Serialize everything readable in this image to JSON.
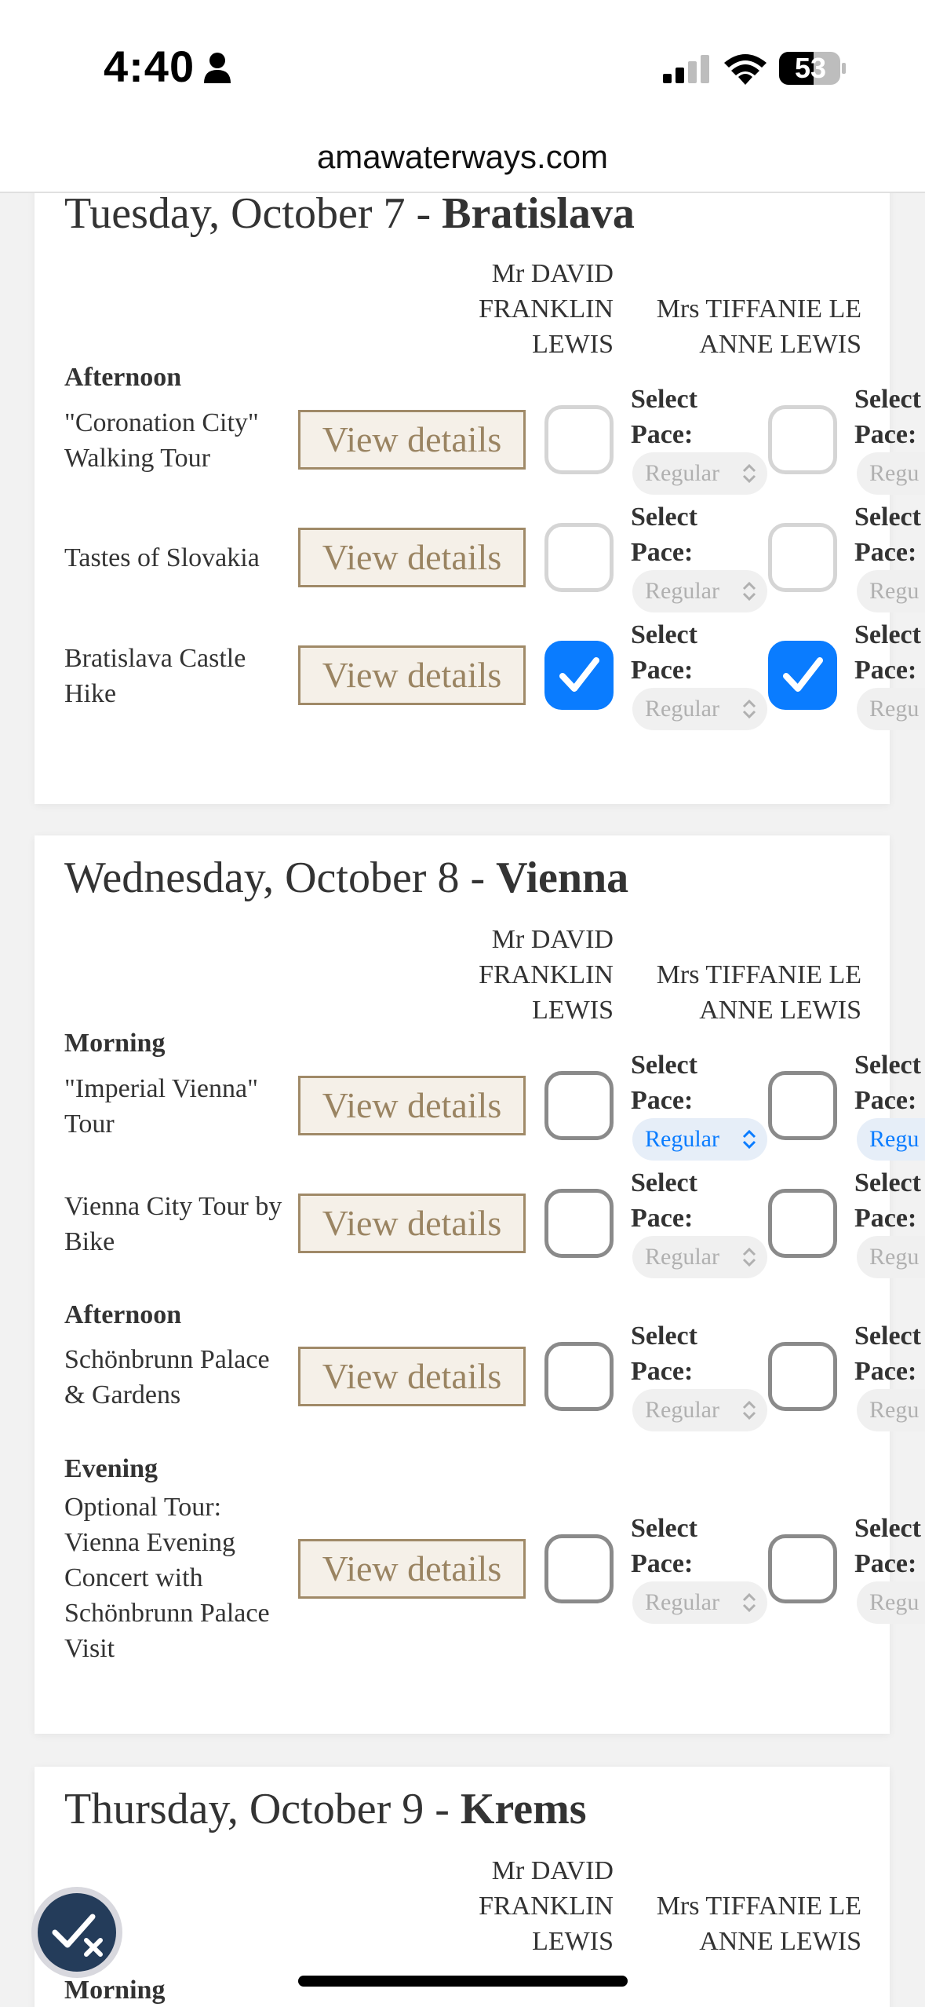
{
  "status": {
    "time": "4:40",
    "battery": "53"
  },
  "browser": {
    "url": "amawaterways.com"
  },
  "passengers": {
    "p1": [
      "Mr DAVID",
      "FRANKLIN",
      "LEWIS"
    ],
    "p2": [
      "Mrs TIFFANIE LE",
      "ANNE LEWIS"
    ]
  },
  "labels": {
    "view": "View details",
    "select": "Select",
    "pace": "Pace:",
    "regular": "Regular",
    "regu": "Regu"
  },
  "days": [
    {
      "date": "Tuesday, October 7 - ",
      "city": "Bratislava",
      "sections": [
        {
          "name": "Afternoon"
        }
      ],
      "tours": [
        {
          "name": "\"Coronation City\" Walking Tour",
          "checked": false
        },
        {
          "name": "Tastes of Slovakia",
          "checked": false
        },
        {
          "name": "Bratislava Castle Hike",
          "checked": true
        }
      ]
    },
    {
      "date": "Wednesday, October 8 - ",
      "city": "Vienna",
      "sections": [
        {
          "name": "Morning"
        },
        {
          "name": "Afternoon"
        },
        {
          "name": "Evening"
        }
      ],
      "tours": [
        {
          "name": "\"Imperial Vienna\" Tour",
          "checked": false,
          "pace_active": true
        },
        {
          "name": "Vienna City Tour by Bike",
          "checked": false
        },
        {
          "name": "Schönbrunn Palace & Gardens",
          "checked": false
        },
        {
          "name": "Optional Tour: Vienna Evening Concert with Schönbrunn Palace Visit",
          "checked": false
        }
      ]
    },
    {
      "date": "Thursday, October 9 - ",
      "city": "Krems",
      "sections": [
        {
          "name": "Morning"
        }
      ]
    }
  ],
  "colors": {
    "checkbox_on": "#0a7cff",
    "button_border": "#a08a68",
    "fab": "#243c5a"
  }
}
